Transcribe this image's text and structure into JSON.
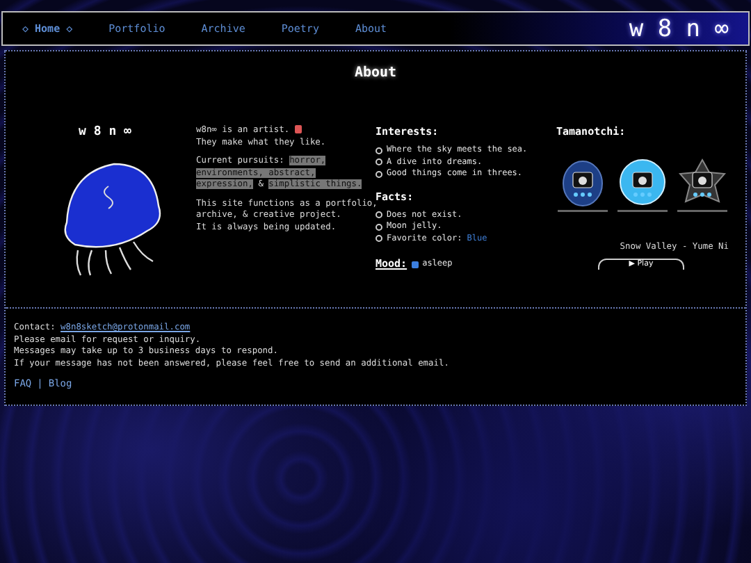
{
  "nav": {
    "active_marker": "◇",
    "items": [
      {
        "label": "Home",
        "selected": true
      },
      {
        "label": "Portfolio",
        "selected": false
      },
      {
        "label": "Archive",
        "selected": false
      },
      {
        "label": "Poetry",
        "selected": false
      },
      {
        "label": "About",
        "selected": false
      }
    ],
    "logo": "w 8 n ∞"
  },
  "page_title": "About",
  "profile": {
    "name": "w 8 n ∞"
  },
  "intro": {
    "lines": [
      "w8n∞ is an artist.",
      "They make what they like."
    ],
    "pursuits": [
      {
        "text": "Current pursuits: ",
        "highlight": false
      },
      {
        "text": "horror, environments, abstract, expression,",
        "highlight": true
      },
      {
        "text": " & ",
        "highlight": false
      },
      {
        "text": "simplistic things.",
        "highlight": true
      }
    ],
    "about": [
      "This site functions as a portfolio,",
      "archive, & creative project.",
      "It is always being updated."
    ]
  },
  "interests": {
    "heading": "Interests:",
    "items": [
      "Where the sky meets the sea.",
      "A dive into dreams.",
      "Good things come in threes."
    ]
  },
  "facts": {
    "heading": "Facts:",
    "items": [
      {
        "text": "Does not exist."
      },
      {
        "text": "Moon jelly."
      },
      {
        "text": "Favorite color: ",
        "value": "Blue",
        "color": "#3f7fd8"
      }
    ]
  },
  "mood": {
    "label": "Mood:",
    "value": "asleep"
  },
  "tamanotchi": {
    "heading": "Tamanotchi:",
    "pets": [
      {
        "kind": "egg"
      },
      {
        "kind": "round"
      },
      {
        "kind": "star"
      }
    ]
  },
  "player": {
    "track": "Snow Valley - Yume Ni",
    "button": "▶ Play"
  },
  "contact": {
    "label": "Contact: ",
    "email": "w8n8sketch@protonmail.com",
    "lines": [
      "Please email for request or inquiry.",
      "Messages may take up to 3 business days to respond.",
      "If your message has not been answered, please feel free to send an additional email."
    ]
  },
  "footer_links": [
    "FAQ",
    "Blog"
  ],
  "footer_separator": "|"
}
